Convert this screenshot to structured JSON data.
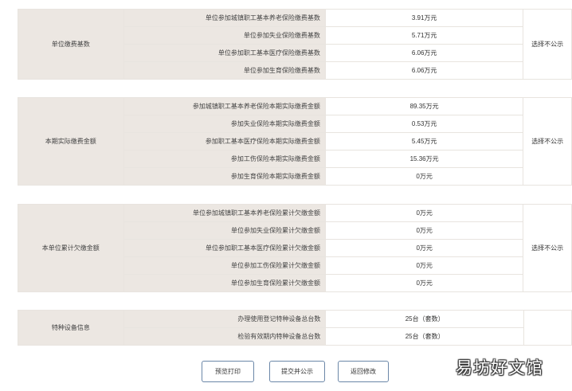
{
  "sections": [
    {
      "label": "单位缴费基数",
      "side": "选择不公示",
      "rows": [
        {
          "item": "单位参加城镇职工基本养老保险缴费基数",
          "value": "3.91万元"
        },
        {
          "item": "单位参加失业保险缴费基数",
          "value": "5.71万元"
        },
        {
          "item": "单位参加职工基本医疗保险缴费基数",
          "value": "6.06万元"
        },
        {
          "item": "单位参加生育保险缴费基数",
          "value": "6.06万元"
        }
      ]
    },
    {
      "label": "本期实际缴费金额",
      "side": "选择不公示",
      "rows": [
        {
          "item": "参加城镇职工基本养老保险本期实际缴费金额",
          "value": "89.35万元"
        },
        {
          "item": "参加失业保险本期实际缴费金额",
          "value": "0.53万元"
        },
        {
          "item": "参加职工基本医疗保险本期实际缴费金额",
          "value": "5.45万元"
        },
        {
          "item": "参加工伤保险本期实际缴费金额",
          "value": "15.36万元"
        },
        {
          "item": "参加生育保险本期实际缴费金额",
          "value": "0万元"
        }
      ]
    },
    {
      "label": "本单位累计欠缴金额",
      "side": "选择不公示",
      "rows": [
        {
          "item": "单位参加城镇职工基本养老保险累计欠缴金额",
          "value": "0万元"
        },
        {
          "item": "单位参加失业保险累计欠缴金额",
          "value": "0万元"
        },
        {
          "item": "单位参加职工基本医疗保险累计欠缴金额",
          "value": "0万元"
        },
        {
          "item": "单位参加工伤保险累计欠缴金额",
          "value": "0万元"
        },
        {
          "item": "单位参加生育保险累计欠缴金额",
          "value": "0万元"
        }
      ]
    },
    {
      "label": "特种设备信息",
      "side": "",
      "rows": [
        {
          "item": "办理使用登记特种设备总台数",
          "value": "25台（套数）"
        },
        {
          "item": "检验有效期内特种设备总台数",
          "value": "25台（套数）"
        }
      ]
    }
  ],
  "buttons": {
    "preview_print": "预览打印",
    "submit_publish": "提交并公示",
    "back_edit": "返回修改"
  },
  "watermark": "易坊好文馆"
}
